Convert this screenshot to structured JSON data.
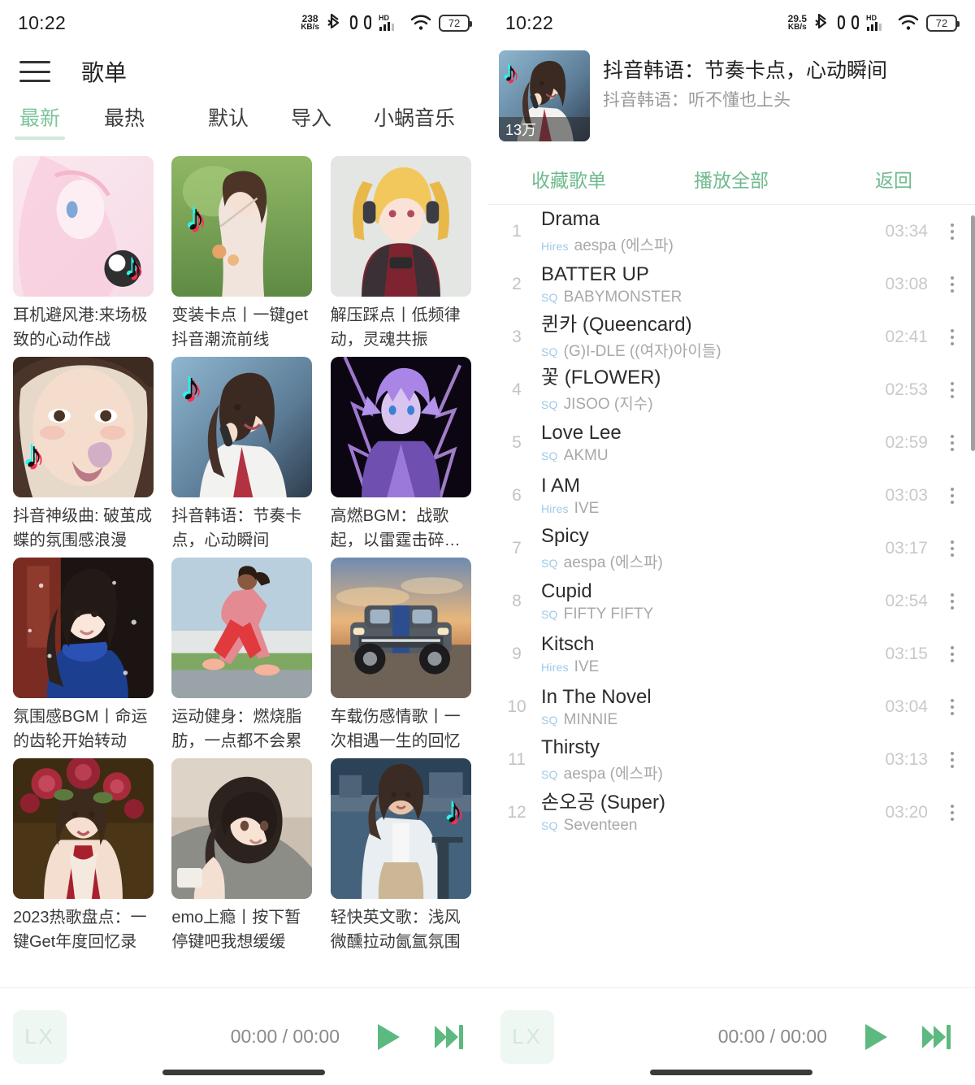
{
  "status_bar_left": {
    "time": "10:22",
    "net_speed_value": "238",
    "net_speed_unit": "KB/s",
    "bluetooth_icon": "bluetooth-icon",
    "earbuds_icon": "earbuds-icon",
    "hd_label": "HD",
    "signal_icon": "signal-icon",
    "wifi_icon": "wifi-icon",
    "battery": "72"
  },
  "status_bar_right": {
    "time": "10:22",
    "net_speed_value": "29.5",
    "net_speed_unit": "KB/s",
    "bluetooth_icon": "bluetooth-icon",
    "earbuds_icon": "earbuds-icon",
    "hd_label": "HD",
    "signal_icon": "signal-icon",
    "wifi_icon": "wifi-icon",
    "battery": "72"
  },
  "left_panel": {
    "menu_icon": "hamburger-menu-icon",
    "title": "歌单",
    "tabs_left": [
      {
        "label": "最新",
        "active": true
      },
      {
        "label": "最热",
        "active": false
      }
    ],
    "tabs_right": [
      {
        "label": "默认",
        "active": false
      },
      {
        "label": "导入",
        "active": false
      },
      {
        "label": "小蜗音乐",
        "active": false
      }
    ],
    "cards": [
      {
        "title": "耳机避风港:来场极致的心动作战",
        "art": "anime-pink-girl",
        "has_tiktok": true
      },
      {
        "title": "变装卡点丨一键get抖音潮流前线",
        "art": "photo-girl-garden",
        "has_tiktok": true
      },
      {
        "title": "解压踩点丨低频律动，灵魂共振",
        "art": "anime-blonde-headphones",
        "has_tiktok": false
      },
      {
        "title": "抖音神级曲: 破茧成蝶的氛围感浪漫",
        "art": "photo-girl-closeup",
        "has_tiktok": true
      },
      {
        "title": "抖音韩语：节奏卡点，心动瞬间",
        "art": "photo-kpop-singer",
        "has_tiktok": true
      },
      {
        "title": "高燃BGM：战歌起，以雷霆击碎…",
        "art": "anime-purple-boy",
        "has_tiktok": false
      },
      {
        "title": "氛围感BGM丨命运的齿轮开始转动",
        "art": "photo-girl-blue-scarf",
        "has_tiktok": false
      },
      {
        "title": "运动健身：燃烧脂肪，一点都不会累",
        "art": "photo-runner",
        "has_tiktok": false
      },
      {
        "title": "车载伤感情歌丨一次相遇一生的回忆",
        "art": "photo-suv-sunset",
        "has_tiktok": false
      },
      {
        "title": "2023热歌盘点：一键Get年度回忆录",
        "art": "photo-girl-roses",
        "has_tiktok": false
      },
      {
        "title": "emo上瘾丨按下暂停键吧我想缓缓",
        "art": "anime-girl-bed",
        "has_tiktok": false
      },
      {
        "title": "轻快英文歌：浅风微醺拉动氤氲氛围",
        "art": "photo-girl-river",
        "has_tiktok": true
      }
    ]
  },
  "right_panel": {
    "playlist": {
      "name": "抖音韩语：节奏卡点，心动瞬间",
      "description": "抖音韩语：听不懂也上头",
      "play_count": "13万",
      "cover": "photo-kpop-singer"
    },
    "actions": [
      {
        "label": "收藏歌单",
        "name": "favorite-playlist-button"
      },
      {
        "label": "播放全部",
        "name": "play-all-button"
      },
      {
        "label": "返回",
        "name": "back-button"
      }
    ],
    "songs": [
      {
        "index": "1",
        "title": "Drama",
        "quality": "Hires",
        "artist": "aespa (에스파)",
        "duration": "03:34"
      },
      {
        "index": "2",
        "title": "BATTER UP",
        "quality": "SQ",
        "artist": "BABYMONSTER",
        "duration": "03:08"
      },
      {
        "index": "3",
        "title": "퀸카 (Queencard)",
        "quality": "SQ",
        "artist": "(G)I-DLE ((여자)아이들)",
        "duration": "02:41"
      },
      {
        "index": "4",
        "title": "꽃 (FLOWER)",
        "quality": "SQ",
        "artist": "JISOO (지수)",
        "duration": "02:53"
      },
      {
        "index": "5",
        "title": "Love Lee",
        "quality": "SQ",
        "artist": "AKMU",
        "duration": "02:59"
      },
      {
        "index": "6",
        "title": "I AM",
        "quality": "Hires",
        "artist": "IVE",
        "duration": "03:03"
      },
      {
        "index": "7",
        "title": "Spicy",
        "quality": "SQ",
        "artist": "aespa (에스파)",
        "duration": "03:17"
      },
      {
        "index": "8",
        "title": "Cupid",
        "quality": "SQ",
        "artist": "FIFTY FIFTY",
        "duration": "02:54"
      },
      {
        "index": "9",
        "title": "Kitsch",
        "quality": "Hires",
        "artist": "IVE",
        "duration": "03:15"
      },
      {
        "index": "10",
        "title": "In The Novel",
        "quality": "SQ",
        "artist": "MINNIE",
        "duration": "03:04"
      },
      {
        "index": "11",
        "title": "Thirsty",
        "quality": "SQ",
        "artist": "aespa (에스파)",
        "duration": "03:13"
      },
      {
        "index": "12",
        "title": "손오공 (Super)",
        "quality": "SQ",
        "artist": "Seventeen",
        "duration": "03:20"
      }
    ]
  },
  "player_left": {
    "logo": "LX",
    "time": "00:00 / 00:00",
    "play_icon": "play-icon",
    "next_icon": "next-track-icon"
  },
  "player_right": {
    "logo": "LX",
    "time": "00:00 / 00:00",
    "play_icon": "play-icon",
    "next_icon": "next-track-icon"
  },
  "theme": {
    "accent_green": "#5cb97f",
    "tab_active": "#7cc49a",
    "badge_blue": "#9ec9e8"
  }
}
